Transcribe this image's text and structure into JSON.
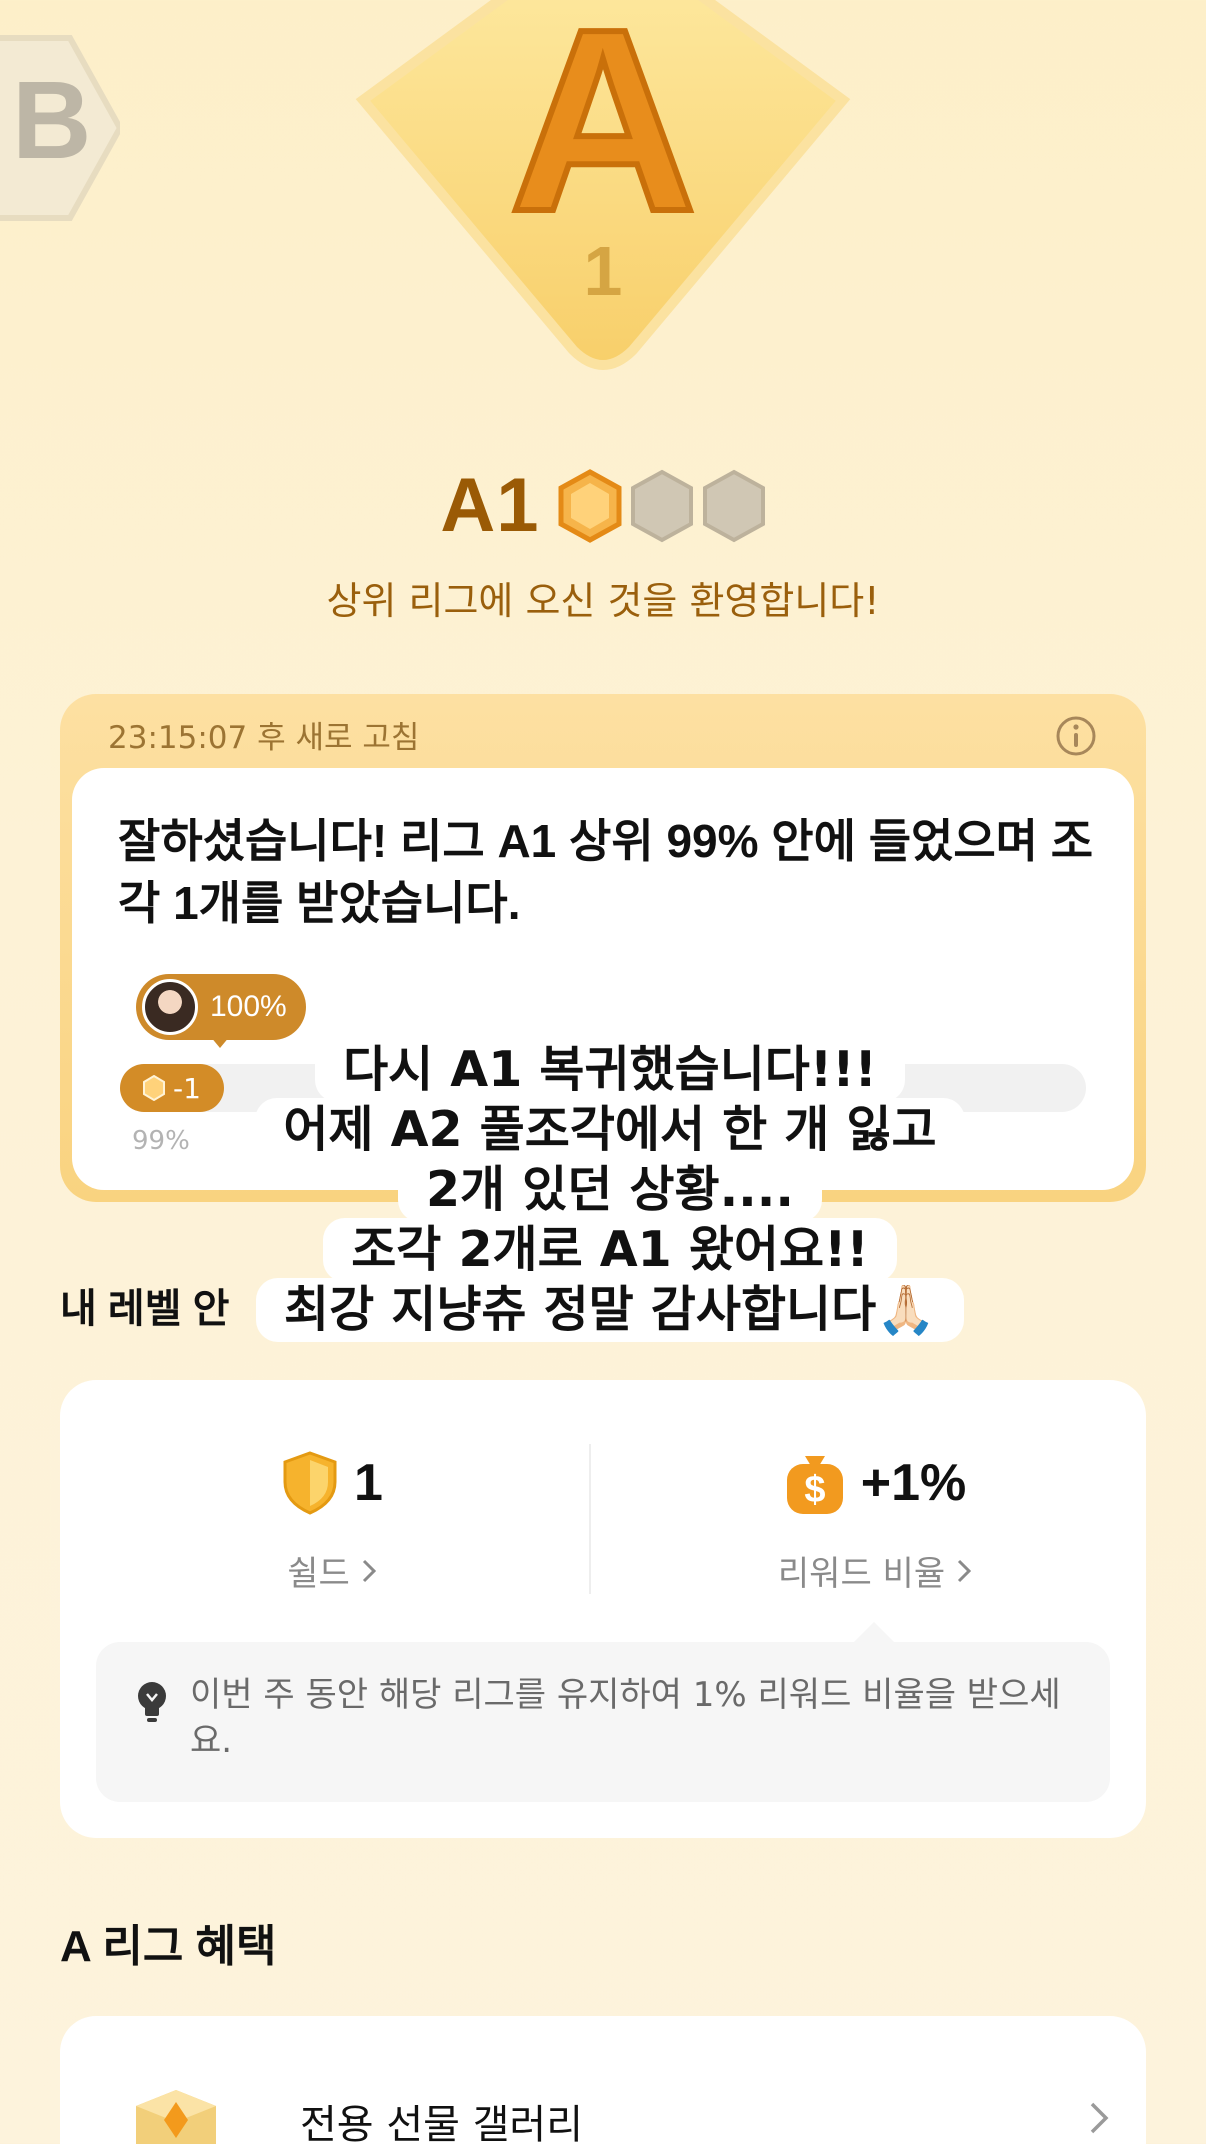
{
  "league": {
    "main_badge_letter": "A",
    "main_badge_level": "1",
    "prev_badge_letter": "B",
    "title": "A1",
    "shards_filled": 1,
    "shards_total": 3,
    "welcome": "상위 리그에 오신 것을 환영합니다!"
  },
  "notice": {
    "refresh": "23:15:07 후 새로 고침",
    "message": "잘하셨습니다! 리그 A1 상위 99% 안에 들었으며 조각 1개를 받았습니다.",
    "avatar_percent": "100%",
    "shard_change": "-1",
    "my_percent": "99%"
  },
  "overlay": {
    "lines": [
      "다시 A1 복귀했습니다!!!",
      "어제 A2 풀조각에서 한 개 잃고",
      "2개 있던 상황....",
      "조각 2개로 A1 왔어요!!",
      "최강 지냥츄 정말 감사합니다"
    ],
    "emoji": "🙏🏻"
  },
  "level_section": {
    "heading": "내 레벨 안",
    "shield_value": "1",
    "shield_label": "쉴드",
    "reward_value": "+1%",
    "reward_label": "리워드 비율",
    "tip": "이번 주 동안 해당 리그를 유지하여 1% 리워드 비율을 받으세요."
  },
  "benefits": {
    "heading": "A 리그 혜택",
    "items": [
      {
        "label": "전용 선물 갤러리",
        "icon": "gift-box-icon"
      }
    ]
  },
  "colors": {
    "accent": "#ce8a2a",
    "title_brown": "#9a5a05",
    "card_bg": "#ffffff",
    "page_bg": "#fdefc9"
  }
}
